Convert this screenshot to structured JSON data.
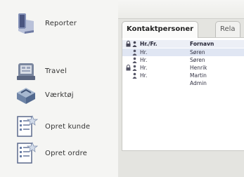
{
  "sidebar": {
    "items": [
      {
        "label": "Reporter",
        "icon": "reporter-icon"
      },
      {
        "label": "Travel",
        "icon": "travel-icon"
      },
      {
        "label": "Værktøj",
        "icon": "toolbox-icon"
      },
      {
        "label": "Opret kunde",
        "icon": "create-customer-icon"
      },
      {
        "label": "Opret ordre",
        "icon": "create-order-icon"
      }
    ]
  },
  "tabs": [
    {
      "label": "Kontaktpersoner",
      "active": true
    },
    {
      "label": "Rela",
      "active": false
    }
  ],
  "table": {
    "headers": {
      "title": "Hr./Fr.",
      "first_name": "Fornavn"
    },
    "rows": [
      {
        "title": "Hr.",
        "first_name": "Søren",
        "locked": false,
        "person_icon": true
      },
      {
        "title": "Hr.",
        "first_name": "Søren",
        "locked": false,
        "person_icon": true
      },
      {
        "title": "Hr.",
        "first_name": "Henrik",
        "locked": true,
        "person_icon": true
      },
      {
        "title": "Hr.",
        "first_name": "Martin",
        "locked": false,
        "person_icon": true
      },
      {
        "title": "",
        "first_name": "Admin",
        "locked": false,
        "person_icon": false
      }
    ]
  },
  "colors": {
    "accent": "#5a6e9a",
    "selected_row": "#e0e6f3"
  }
}
